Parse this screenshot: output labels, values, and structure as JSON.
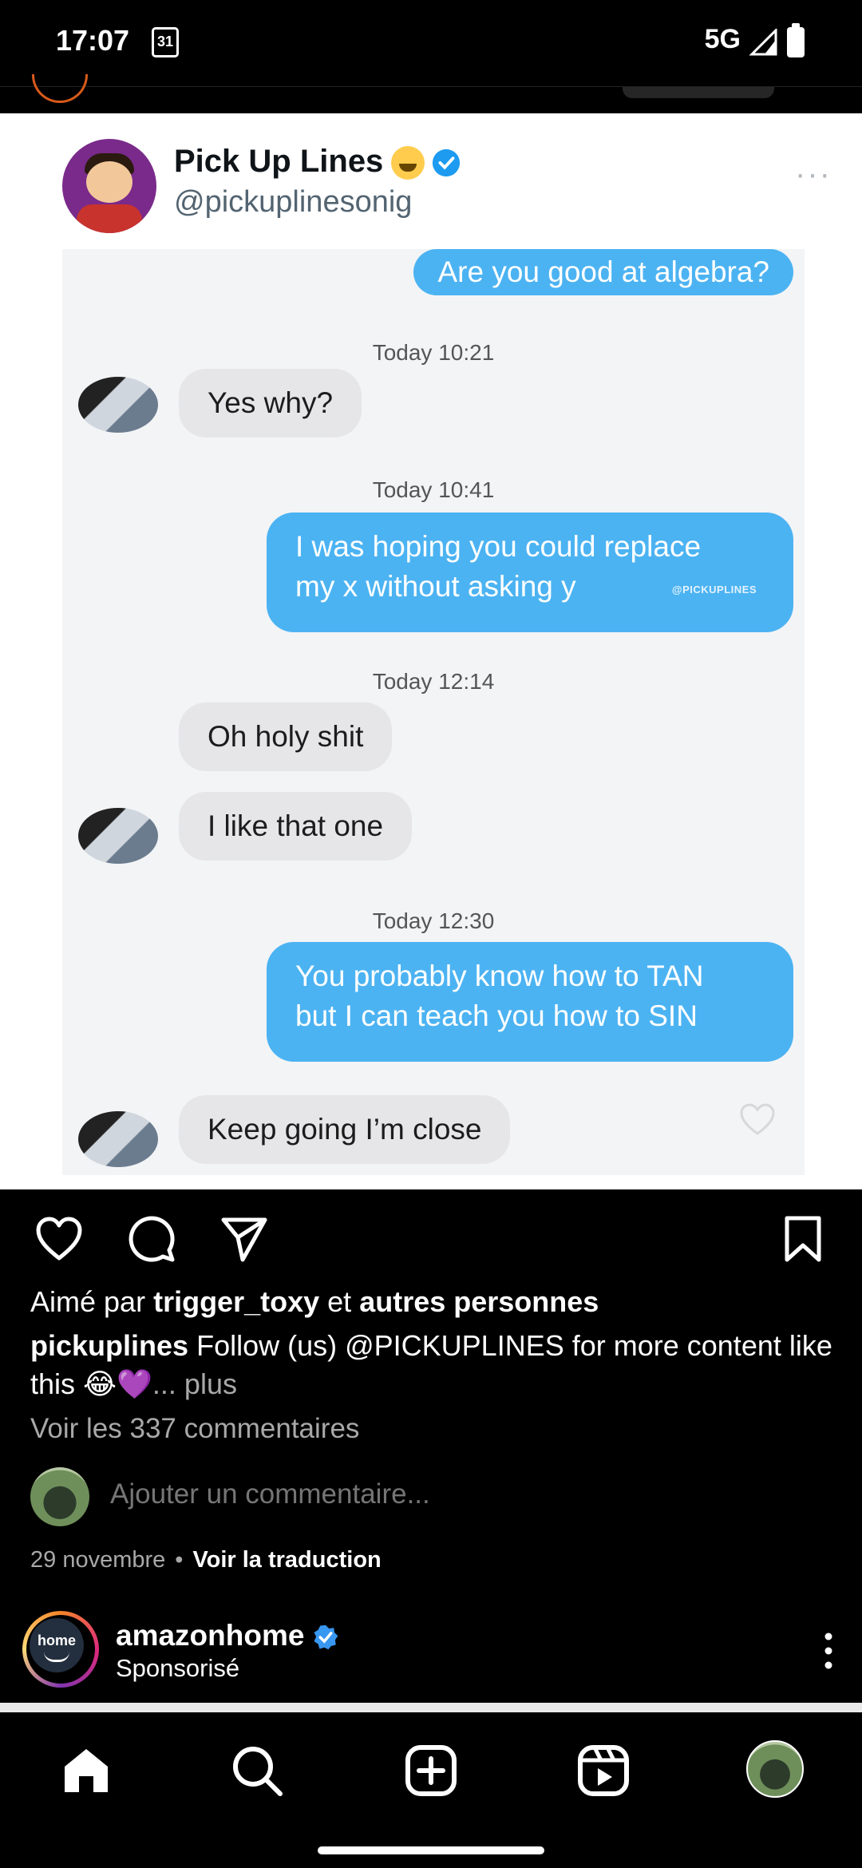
{
  "status_bar": {
    "time": "17:07",
    "calendar_day": "31",
    "network": "5G"
  },
  "tweet": {
    "display_name": "Pick Up Lines",
    "handle": "@pickuplinesonig",
    "more": "···"
  },
  "chat": {
    "messages": [
      {
        "type": "out",
        "text": "Are you good at algebra?"
      },
      {
        "type": "time",
        "text": "Today 10:21"
      },
      {
        "type": "in",
        "text": "Yes why?"
      },
      {
        "type": "time",
        "text": "Today 10:41"
      },
      {
        "type": "out",
        "lines": [
          "I was hoping you could replace",
          "my x without asking y"
        ]
      },
      {
        "type": "time",
        "text": "Today 12:14"
      },
      {
        "type": "in",
        "text": "Oh holy shit"
      },
      {
        "type": "in",
        "text": "I like that one"
      },
      {
        "type": "time",
        "text": "Today 12:30"
      },
      {
        "type": "out",
        "lines": [
          "You probably know how to TAN",
          "but I can teach you how to SIN"
        ]
      },
      {
        "type": "in",
        "text": "Keep going I’m close"
      }
    ],
    "watermark": "@PICKUPLINES"
  },
  "post": {
    "likes_prefix": "Aimé par",
    "likes_user": "trigger_toxy",
    "likes_mid": "et",
    "likes_suffix": "autres personnes",
    "caption_user": "pickuplines",
    "caption_text": "Follow (us) @PICKUPLINES for more content like this 😂💜",
    "caption_more": "... plus",
    "view_comments": "Voir les 337 commentaires",
    "add_comment_placeholder": "Ajouter un commentaire...",
    "date": "29 novembre",
    "dot": "•",
    "translate": "Voir la traduction"
  },
  "next_post": {
    "logo_text": "home",
    "username": "amazonhome",
    "subtitle": "Sponsorisé"
  },
  "icons": {
    "like": "heart-outline",
    "comment": "speech-bubble",
    "share": "paper-plane",
    "save": "bookmark",
    "nav_home": "home-filled",
    "nav_search": "magnifier",
    "nav_create": "plus-square",
    "nav_reels": "reels"
  },
  "colors": {
    "bubble_out": "#4cb3f2",
    "bubble_in": "#e6e6e9",
    "verified": "#1d9bf0",
    "background": "#000000"
  }
}
